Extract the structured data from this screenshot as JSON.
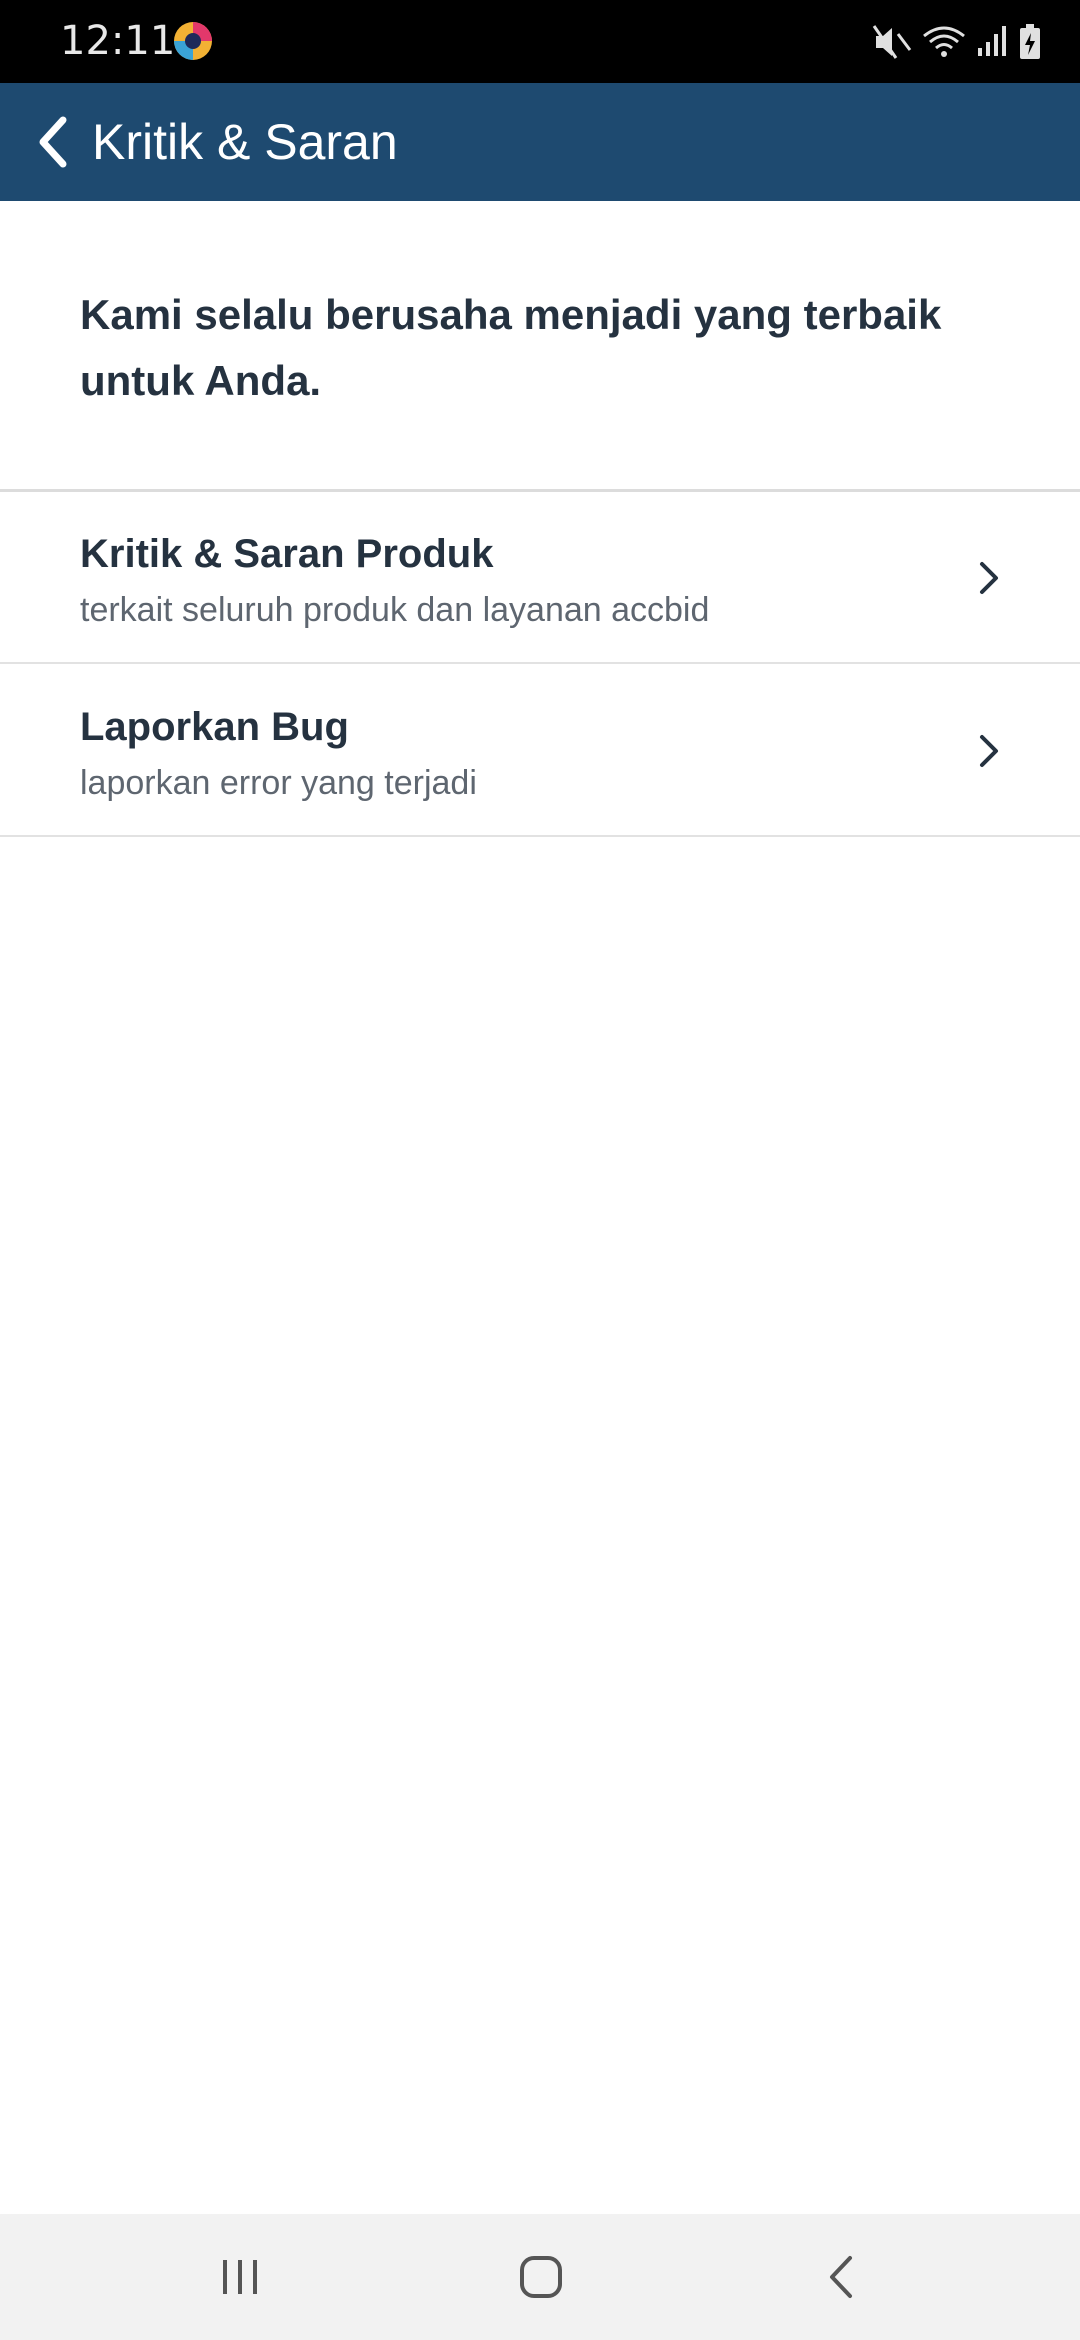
{
  "status_bar": {
    "time": "12:11",
    "icons": [
      "app-notification-icon",
      "mute-icon",
      "wifi-icon",
      "signal-icon",
      "battery-icon"
    ]
  },
  "app_bar": {
    "title": "Kritik & Saran",
    "back_icon": "chevron-left-icon",
    "background": "#1e4a70"
  },
  "intro": {
    "text": "Kami selalu berusaha menjadi yang terbaik untuk Anda."
  },
  "menu": {
    "items": [
      {
        "title": "Kritik & Saran Produk",
        "subtitle": "terkait seluruh produk dan layanan accbid",
        "icon": "chevron-right-icon"
      },
      {
        "title": "Laporkan Bug",
        "subtitle": "laporkan error yang terjadi",
        "icon": "chevron-right-icon"
      }
    ]
  },
  "nav_bar": {
    "buttons": [
      "recent-apps-icon",
      "home-icon",
      "back-icon"
    ]
  }
}
